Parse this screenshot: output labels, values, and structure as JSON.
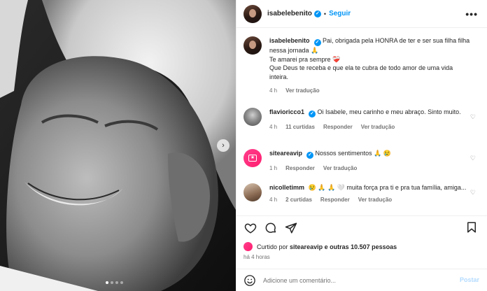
{
  "post": {
    "author": "isabelebenito",
    "follow_label": "Seguir",
    "separator": "•",
    "more_label": "•••"
  },
  "caption": {
    "user": "isabelebenito",
    "line1": "Pai, obrigada pela HONRA de ter e ser sua filha filha nessa jornada 🙏",
    "line2": "Te amarei pra sempre ❤️‍🩹",
    "line3": "Que Deus te receba e que ela te cubra de todo amor de uma vida inteira.",
    "time": "4 h",
    "translate": "Ver tradução"
  },
  "comments": [
    {
      "user": "flavioricco1",
      "text": "Oi Isabele, meu carinho e meu abraço. Sinto muito.",
      "time": "4 h",
      "likes": "11 curtidas",
      "reply": "Responder",
      "translate": "Ver tradução"
    },
    {
      "user": "siteareavip",
      "text": "Nossos sentimentos 🙏 😢",
      "time": "1 h",
      "reply": "Responder",
      "translate": "Ver tradução"
    },
    {
      "user": "nicolletimm",
      "text": "😢 🙏 🙏 🤍 muita força pra ti e pra tua família, amiga...",
      "time": "4 h",
      "likes": "2 curtidas",
      "reply": "Responder",
      "translate": "Ver tradução"
    }
  ],
  "likes": {
    "prefix": "Curtido por",
    "user": "siteareavip",
    "suffix": "e outras 10.507 pessoas"
  },
  "timestamp": "há 4 horas",
  "composer": {
    "placeholder": "Adicione um comentário...",
    "post_label": "Postar"
  },
  "carousel": {
    "dot_count": 4,
    "active_index": 0
  },
  "colors": {
    "accent": "#0095f6",
    "muted": "#737373",
    "post_disabled": "#b3dbff"
  },
  "icons": [
    "heart-icon",
    "comment-icon",
    "share-icon",
    "bookmark-icon",
    "emoji-icon",
    "chevron-right-icon",
    "more-icon",
    "verified-icon"
  ]
}
